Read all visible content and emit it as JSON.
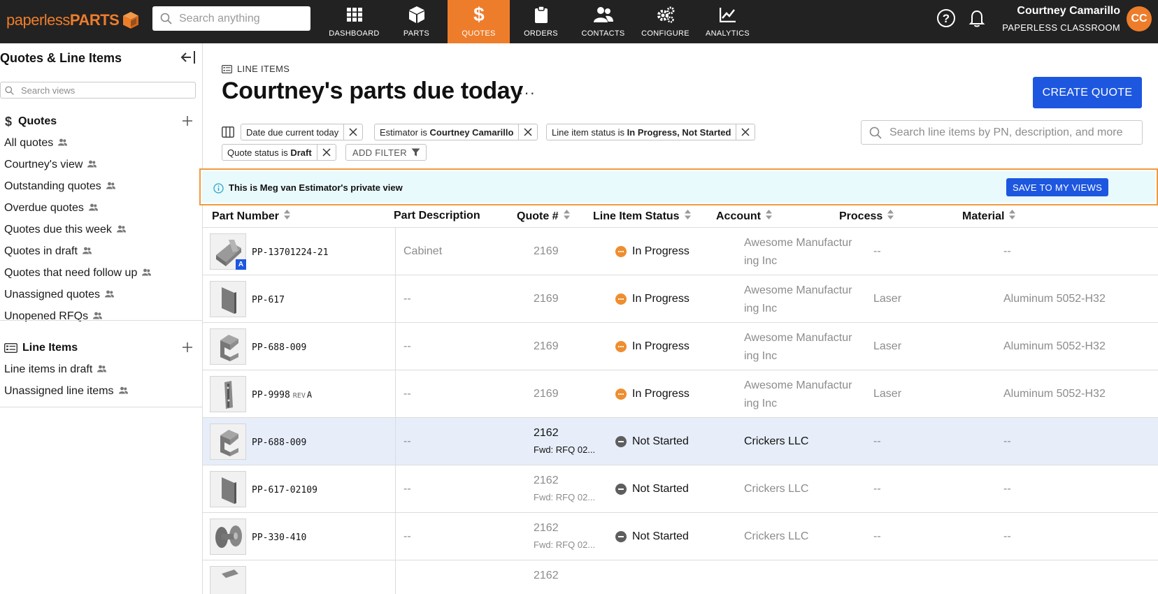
{
  "app": {
    "logo_light": "paperless",
    "logo_bold": "PARTS",
    "search_placeholder": "Search anything",
    "nav": [
      {
        "label": "DASHBOARD",
        "icon": "grid-icon"
      },
      {
        "label": "PARTS",
        "icon": "cube-icon"
      },
      {
        "label": "QUOTES",
        "icon": "dollar-icon",
        "active": true
      },
      {
        "label": "ORDERS",
        "icon": "clipboard-icon"
      },
      {
        "label": "CONTACTS",
        "icon": "contacts-icon"
      },
      {
        "label": "CONFIGURE",
        "icon": "gears-icon"
      },
      {
        "label": "ANALYTICS",
        "icon": "chart-icon"
      }
    ],
    "user": {
      "name": "Courtney Camarillo",
      "org": "PAPERLESS CLASSROOM",
      "initials": "CC"
    },
    "accent": "#ee7d2b",
    "primary_blue": "#1d57e0"
  },
  "sidebar": {
    "title": "Quotes & Line Items",
    "search_placeholder": "Search views",
    "quotes": {
      "heading": "Quotes",
      "items": [
        "All quotes",
        "Courtney's view",
        "Outstanding quotes",
        "Overdue quotes",
        "Quotes due this week",
        "Quotes in draft",
        "Quotes that need follow up",
        "Unassigned quotes",
        "Unopened RFQs"
      ]
    },
    "line_items": {
      "heading": "Line Items",
      "items": [
        "Line items in draft",
        "Unassigned line items"
      ]
    }
  },
  "main": {
    "breadcrumb": "LINE ITEMS",
    "title": "Courtney's parts due today",
    "more": "···",
    "create_button": "CREATE QUOTE",
    "search_placeholder": "Search line items by PN, description, and more",
    "filters": [
      {
        "prefix": "Date due current today",
        "value": ""
      },
      {
        "prefix": "Estimator is ",
        "value": "Courtney Camarillo"
      },
      {
        "prefix": "Line item status is ",
        "value": "In Progress, Not Started"
      },
      {
        "prefix": "Quote status is ",
        "value": "Draft"
      }
    ],
    "add_filter": "ADD FILTER",
    "banner": {
      "text": "This is Meg van Estimator's private view",
      "button": "SAVE TO MY VIEWS"
    }
  },
  "table": {
    "columns": [
      "Part Number",
      "Part Description",
      "Quote #",
      "Line Item Status",
      "Account",
      "Process",
      "Material"
    ],
    "rows": [
      {
        "pn": "PP-13701224-21",
        "rev": "",
        "desc": "Cabinet",
        "quote": "2169",
        "fwd": "",
        "status": "In Progress",
        "account": "Awesome Manufactur ing Inc",
        "process": "--",
        "material": "--",
        "badge": "A",
        "thumb": "cabinet"
      },
      {
        "pn": "PP-617",
        "rev": "",
        "desc": "--",
        "quote": "2169",
        "fwd": "",
        "status": "In Progress",
        "account": "Awesome Manufactur ing Inc",
        "process": "Laser",
        "material": "Aluminum 5052-H32",
        "badge": "",
        "thumb": "plate"
      },
      {
        "pn": "PP-688-009",
        "rev": "",
        "desc": "--",
        "quote": "2169",
        "fwd": "",
        "status": "In Progress",
        "account": "Awesome Manufactur ing Inc",
        "process": "Laser",
        "material": "Aluminum 5052-H32",
        "badge": "",
        "thumb": "bracket"
      },
      {
        "pn": "PP-9998",
        "rev": "A",
        "desc": "--",
        "quote": "2169",
        "fwd": "",
        "status": "In Progress",
        "account": "Awesome Manufactur ing Inc",
        "process": "Laser",
        "material": "Aluminum 5052-H32",
        "badge": "",
        "thumb": "hinge"
      },
      {
        "pn": "PP-688-009",
        "rev": "",
        "desc": "--",
        "quote": "2162",
        "fwd": "Fwd: RFQ 02...",
        "status": "Not Started",
        "account": "Crickers LLC",
        "process": "--",
        "material": "--",
        "badge": "",
        "thumb": "bracket",
        "highlight": true
      },
      {
        "pn": "PP-617-02109",
        "rev": "",
        "desc": "--",
        "quote": "2162",
        "fwd": "Fwd: RFQ 02...",
        "status": "Not Started",
        "account": "Crickers LLC",
        "process": "--",
        "material": "--",
        "badge": "",
        "thumb": "plate"
      },
      {
        "pn": "PP-330-410",
        "rev": "",
        "desc": "--",
        "quote": "2162",
        "fwd": "Fwd: RFQ 02...",
        "status": "Not Started",
        "account": "Crickers LLC",
        "process": "--",
        "material": "--",
        "badge": "",
        "thumb": "spool"
      },
      {
        "pn": "",
        "rev": "",
        "desc": "",
        "quote": "2162",
        "fwd": "",
        "status": "",
        "account": "",
        "process": "",
        "material": "",
        "badge": "",
        "thumb": "partial"
      }
    ],
    "rev_label": "REV"
  }
}
